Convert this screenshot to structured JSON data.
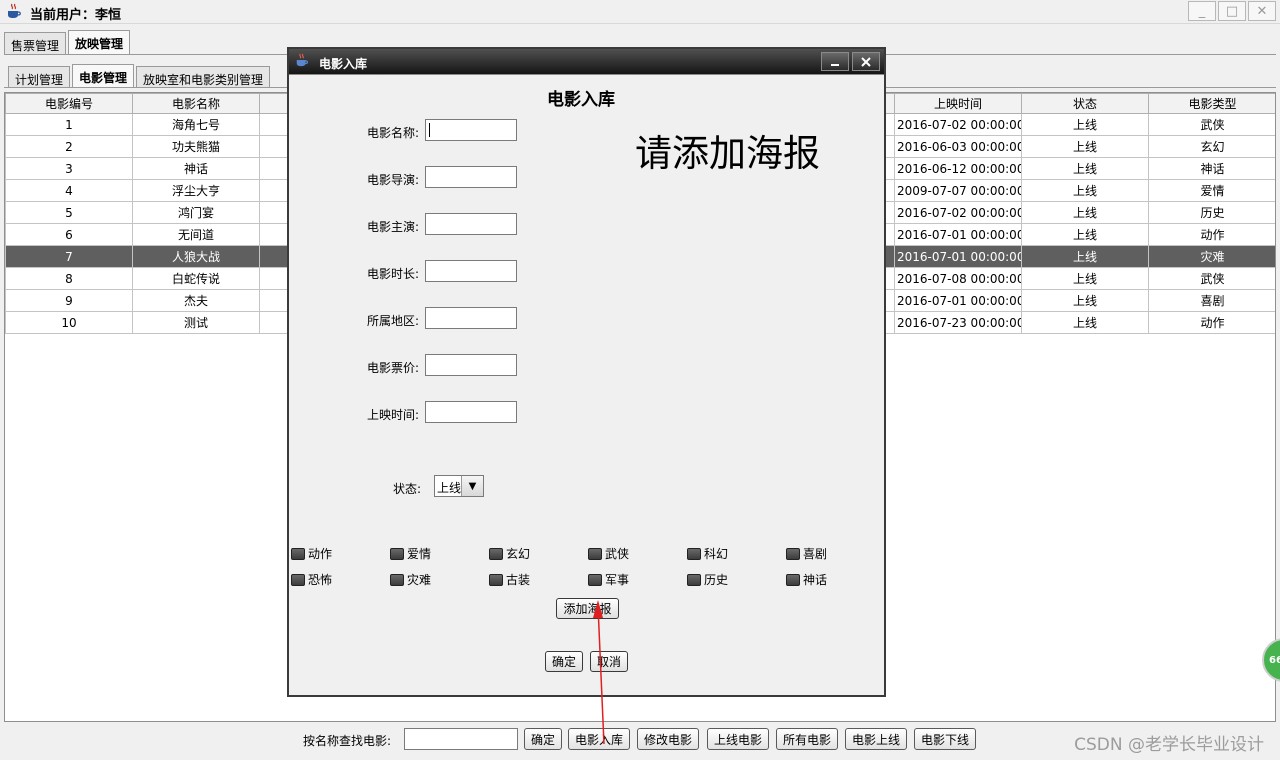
{
  "window": {
    "title": "当前用户：李恒",
    "controls": [
      "_",
      "□",
      "✕"
    ]
  },
  "tabs_top": [
    "售票管理",
    "放映管理"
  ],
  "tabs_sub": [
    "计划管理",
    "电影管理",
    "放映室和电影类别管理"
  ],
  "table": {
    "headers": [
      "电影编号",
      "电影名称",
      "",
      "",
      "",
      "",
      "",
      "上映时间",
      "状态",
      "电影类型"
    ],
    "rows": [
      [
        "1",
        "海角七号",
        "2016-07-02 00:00:00...",
        "上线",
        "武侠"
      ],
      [
        "2",
        "功夫熊猫",
        "2016-06-03 00:00:00...",
        "上线",
        "玄幻"
      ],
      [
        "3",
        "神话",
        "2016-06-12 00:00:00...",
        "上线",
        "神话"
      ],
      [
        "4",
        "浮尘大亨",
        "2009-07-07 00:00:00...",
        "上线",
        "爱情"
      ],
      [
        "5",
        "鸿门宴",
        "2016-07-02 00:00:00...",
        "上线",
        "历史"
      ],
      [
        "6",
        "无间道",
        "2016-07-01 00:00:00...",
        "上线",
        "动作"
      ],
      [
        "7",
        "人狼大战",
        "2016-07-01 00:00:00...",
        "上线",
        "灾难"
      ],
      [
        "8",
        "白蛇传说",
        "2016-07-08 00:00:00...",
        "上线",
        "武侠"
      ],
      [
        "9",
        "杰夫",
        "2016-07-01 00:00:00...",
        "上线",
        "喜剧"
      ],
      [
        "10",
        "测试",
        "2016-07-23 00:00:00...",
        "上线",
        "动作"
      ]
    ],
    "selected_row": 7
  },
  "bottom": {
    "search_label": "按名称查找电影:",
    "search_value": "",
    "buttons": [
      "确定",
      "电影入库",
      "修改电影",
      "上线电影",
      "所有电影",
      "电影上线",
      "电影下线"
    ],
    "watermark": "CSDN @老学长毕业设计"
  },
  "badge": "66",
  "dialog": {
    "title": "电影入库",
    "heading": "电影入库",
    "poster_placeholder": "请添加海报",
    "fields": [
      {
        "label": "电影名称:",
        "value": ""
      },
      {
        "label": "电影导演:",
        "value": ""
      },
      {
        "label": "电影主演:",
        "value": ""
      },
      {
        "label": "电影时长:",
        "value": ""
      },
      {
        "label": "所属地区:",
        "value": ""
      },
      {
        "label": "电影票价:",
        "value": ""
      },
      {
        "label": "上映时间:",
        "value": ""
      }
    ],
    "status_label": "状态:",
    "status_value": "上线",
    "genres": [
      "动作",
      "爱情",
      "玄幻",
      "武侠",
      "科幻",
      "喜剧",
      "恐怖",
      "灾难",
      "古装",
      "军事",
      "历史",
      "神话"
    ],
    "add_poster_button": "添加海报",
    "ok_button": "确定",
    "cancel_button": "取消"
  }
}
